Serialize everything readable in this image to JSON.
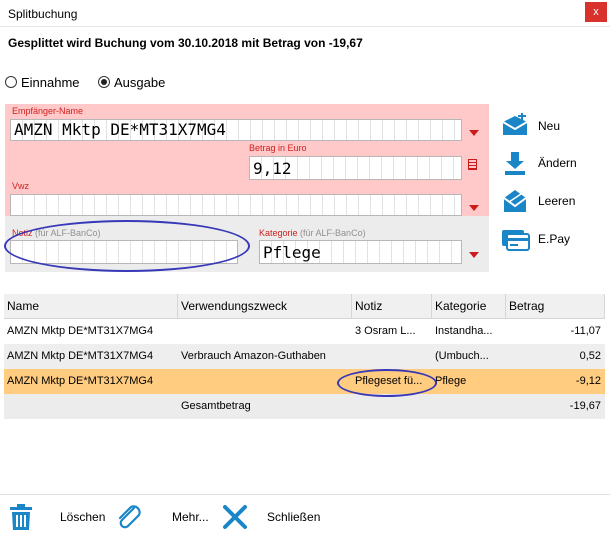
{
  "window": {
    "title": "Splitbuchung",
    "close_label": "x"
  },
  "heading": "Gesplittet wird Buchung vom 30.10.2018 mit Betrag von -19,67",
  "type": {
    "options": [
      "Einnahme",
      "Ausgabe"
    ],
    "selected": "Ausgabe"
  },
  "form": {
    "empfaenger": {
      "label": "Empfänger-Name",
      "value": "AMZN Mktp DE*MT31X7MG4"
    },
    "betrag": {
      "label": "Betrag in Euro",
      "value": "9,12"
    },
    "vwz": {
      "label": "Vwz",
      "value": ""
    },
    "notiz": {
      "label": "Notiz",
      "hint": "(für ALF-BanCo)",
      "value": ""
    },
    "kategorie": {
      "label": "Kategorie",
      "hint": "(für ALF-BanCo)",
      "value": "Pflege"
    }
  },
  "actions": {
    "neu": "Neu",
    "aendern": "Ändern",
    "leeren": "Leeren",
    "epay": "E.Pay"
  },
  "table": {
    "columns": [
      "Name",
      "Verwendungszweck",
      "Notiz",
      "Kategorie",
      "Betrag"
    ],
    "rows": [
      {
        "name": "AMZN Mktp DE*MT31X7MG4",
        "vwz": "",
        "notiz": "3 Osram L...",
        "kategorie": "Instandha...",
        "betrag": "-11,07"
      },
      {
        "name": "AMZN Mktp DE*MT31X7MG4",
        "vwz": "Verbrauch Amazon-Guthaben",
        "notiz": "",
        "kategorie": "(Umbuch...",
        "betrag": "0,52"
      },
      {
        "name": "AMZN Mktp DE*MT31X7MG4",
        "vwz": "",
        "notiz": "Pflegeset fü...",
        "kategorie": "Pflege",
        "betrag": "-9,12"
      }
    ],
    "total": {
      "label": "Gesamtbetrag",
      "value": "-19,67"
    }
  },
  "footer": {
    "loeschen": "Löschen",
    "mehr": "Mehr...",
    "schliessen": "Schließen"
  },
  "colors": {
    "accent_red": "#cc1b1b",
    "form_pink": "#ffc9c9",
    "selected_row": "#ffcc80",
    "icon_blue": "#1a86c8",
    "annotation_oval": "#3838b8"
  }
}
